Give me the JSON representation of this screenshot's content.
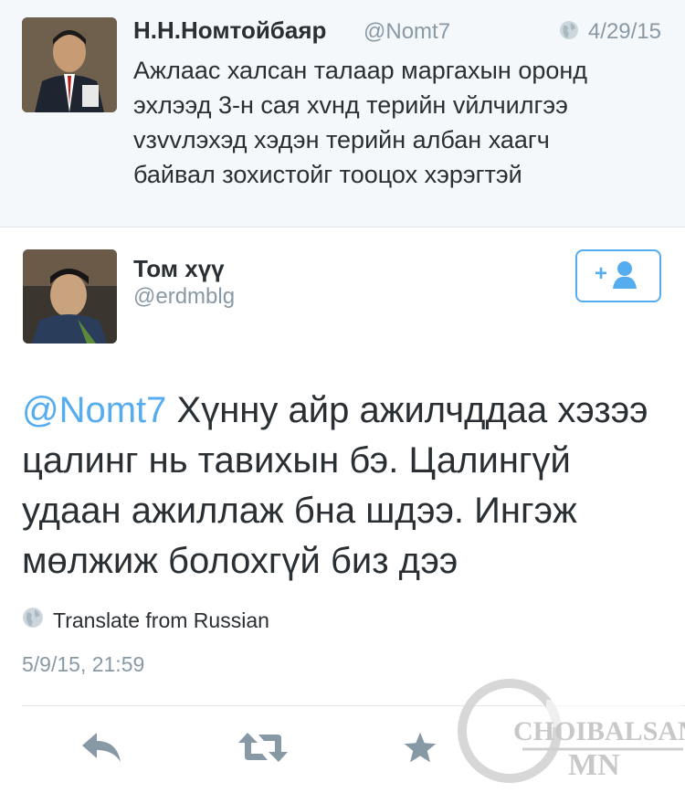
{
  "parent_tweet": {
    "name": "Н.Н.Номтойбаяр",
    "handle": "@Nomt7",
    "date": "4/29/15",
    "text": "Ажлаас халсан талаар маргахын оронд\nэхлээд 3-н сая хvнд терийн vйлчилгээ\nvзvvлэхэд хэдэн терийн албан хаагч\nбайвал зохистойг тооцох хэрэгтэй"
  },
  "reply_tweet": {
    "name": "Том хүү",
    "handle": "@erdmblg",
    "mention": "@Nomt7",
    "text": " Хүнну айр ажилчддаа хэзээ цалинг нь тавихын бэ. Цалингүй удаан ажиллаж бна шдээ. Ингэж мөлжиж болохгүй биз дээ",
    "translate_label": "Translate from Russian",
    "timestamp": "5/9/15, 21:59"
  },
  "watermark": {
    "text_top": "CHOIBALSAN",
    "text_bottom": "MN"
  },
  "colors": {
    "accent": "#55acee",
    "muted": "#8899a6",
    "text": "#292f33",
    "icon": "#8899a6"
  }
}
